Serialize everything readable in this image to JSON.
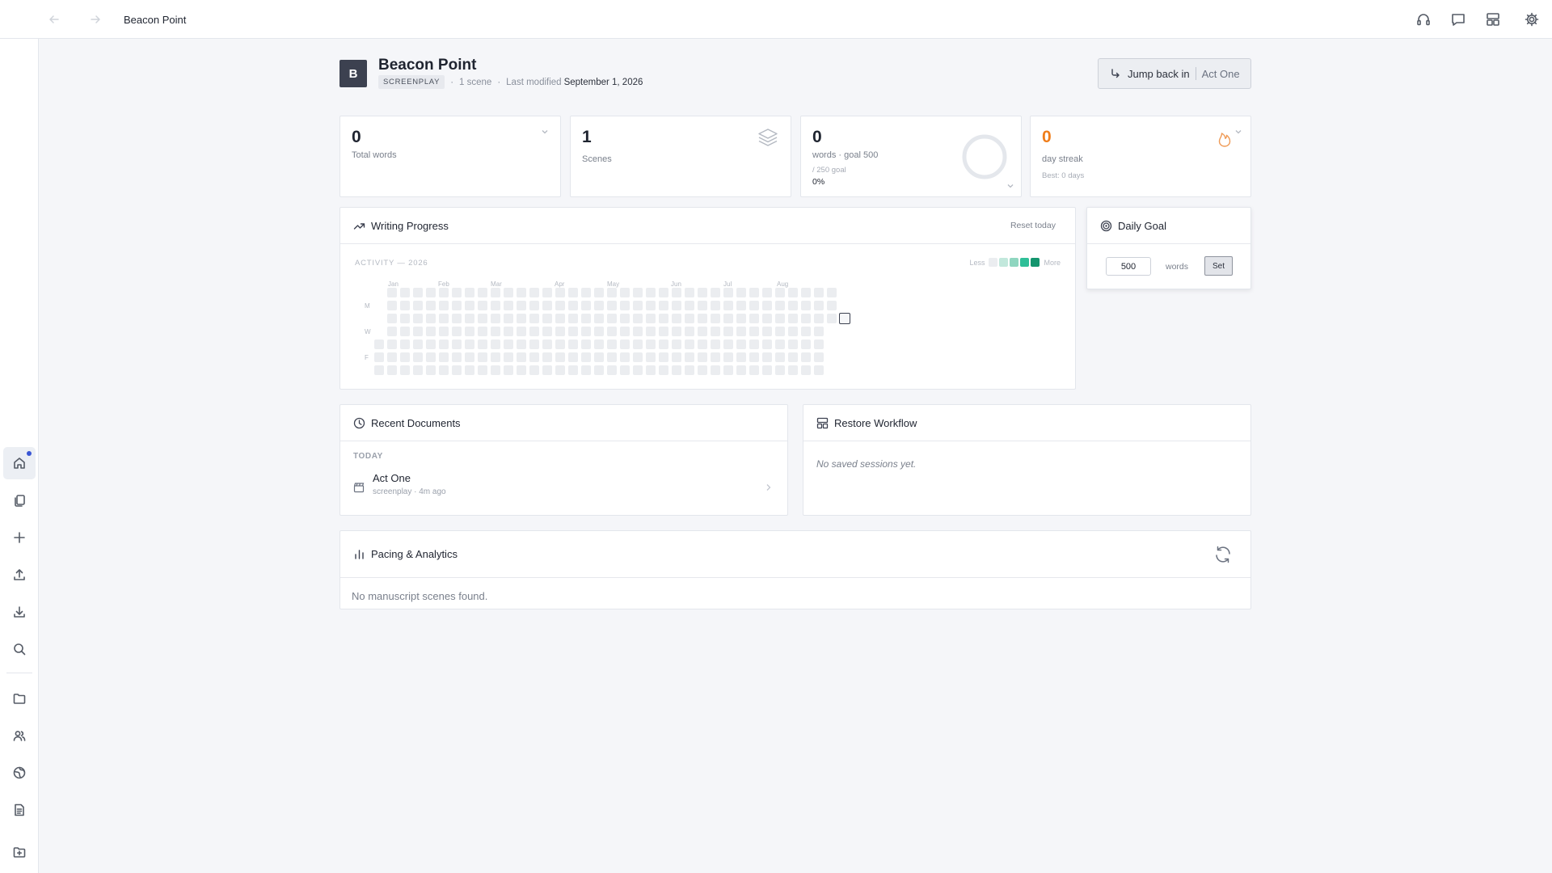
{
  "topbar": {
    "title": "Beacon Point"
  },
  "project": {
    "badge": "B",
    "title": "Beacon Point",
    "type": "SCREENPLAY",
    "scene_count": "1 scene",
    "modified_label": "Last modified",
    "modified_date": "September 1, 2026",
    "jump_label": "Jump back in",
    "jump_target": "Act One"
  },
  "stats": {
    "total_words": {
      "value": "0",
      "label": "Total words"
    },
    "scenes": {
      "value": "1",
      "label": "Scenes"
    },
    "goal": {
      "value": "0",
      "label": "words · goal 500",
      "sub": "/ 250 goal",
      "percent": "0%"
    },
    "streak": {
      "value": "0",
      "label": "day streak",
      "best": "Best: 0 days"
    }
  },
  "progress": {
    "title": "Writing Progress",
    "reset": "Reset today",
    "activity_title": "ACTIVITY — 2026",
    "legend_less": "Less",
    "legend_more": "More",
    "legend_colors": [
      "#ebedf0",
      "#c2e8dc",
      "#8fd6c0",
      "#2fbf98",
      "#14956e"
    ],
    "months": [
      "Jan",
      "Feb",
      "Mar",
      "Apr",
      "May",
      "Jun",
      "Jul",
      "Aug"
    ],
    "days": [
      "M",
      "W",
      "F"
    ]
  },
  "daily_goal": {
    "title": "Daily Goal",
    "value": "500",
    "unit": "words",
    "set_label": "Set"
  },
  "recent": {
    "title": "Recent Documents",
    "section": "TODAY",
    "items": [
      {
        "title": "Act One",
        "sub": "screenplay · 4m ago"
      }
    ]
  },
  "restore": {
    "title": "Restore Workflow",
    "empty": "No saved sessions yet."
  },
  "pacing": {
    "title": "Pacing & Analytics",
    "empty": "No manuscript scenes found."
  },
  "colors": {
    "accent": "#3a56d4",
    "streak": "#ef7d1a",
    "badge": "#3c4150"
  }
}
